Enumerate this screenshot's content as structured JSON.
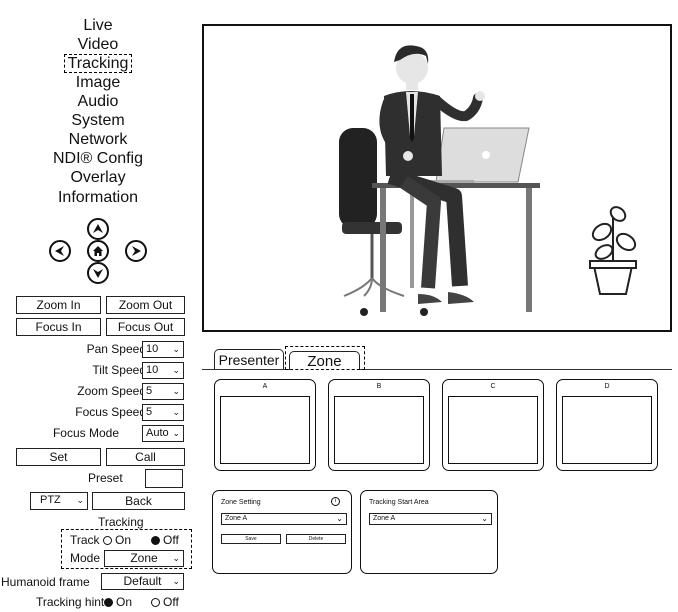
{
  "menu": {
    "items": [
      "Live",
      "Video",
      "Tracking",
      "Image",
      "Audio",
      "System",
      "Network",
      "NDI® Config",
      "Overlay",
      "Information"
    ],
    "selected_index": 2
  },
  "ptz_pad": {
    "up_icon": "arrow-up-icon",
    "down_icon": "arrow-down-icon",
    "left_icon": "arrow-left-icon",
    "right_icon": "arrow-right-icon",
    "home_icon": "home-icon"
  },
  "buttons": {
    "zoom_in": "Zoom In",
    "zoom_out": "Zoom Out",
    "focus_in": "Focus In",
    "focus_out": "Focus Out",
    "set": "Set",
    "call": "Call",
    "back": "Back"
  },
  "speeds": {
    "pan_label": "Pan Speed",
    "pan_value": "10",
    "tilt_label": "Tilt Speed",
    "tilt_value": "10",
    "zoom_label": "Zoom Speed",
    "zoom_value": "5",
    "focus_label": "Focus Speed",
    "focus_value": "5",
    "focus_mode_label": "Focus Mode",
    "focus_mode_value": "Auto"
  },
  "preset": {
    "label": "Preset",
    "value": ""
  },
  "ptz_select": "PTZ",
  "tracking": {
    "heading": "Tracking",
    "track_label": "Track",
    "on_label": "On",
    "off_label": "Off",
    "track_value": "Off",
    "mode_label": "Mode",
    "mode_value": "Zone",
    "humanoid_label": "Humanoid frame",
    "humanoid_value": "Default",
    "hint_label": "Tracking hint",
    "hint_on": "On",
    "hint_off": "Off",
    "hint_value": "On"
  },
  "tabs": {
    "presenter": "Presenter",
    "zone": "Zone",
    "active": "Zone"
  },
  "zones": [
    "A",
    "B",
    "C",
    "D"
  ],
  "zone_setting": {
    "title": "Zone Setting",
    "info_icon": "info-icon",
    "select_value": "Zone A",
    "save": "Save",
    "delete": "Delete"
  },
  "tracking_start_area": {
    "title": "Tracking Start Area",
    "select_value": "Zone A"
  }
}
